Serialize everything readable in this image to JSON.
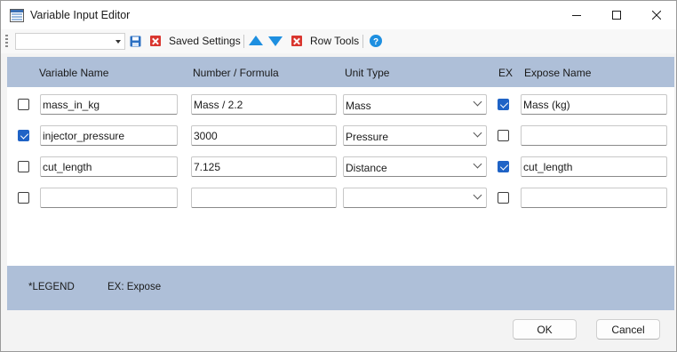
{
  "window": {
    "title": "Variable Input Editor",
    "app_icon": "spreadsheet-icon",
    "controls": [
      "minimize-icon",
      "maximize-icon",
      "close-icon"
    ]
  },
  "toolbar": {
    "combo_value": "",
    "save_icon": "floppy-disk-icon",
    "saved_settings_label": "Saved Settings",
    "move_up_icon": "arrow-up-icon",
    "move_down_icon": "arrow-down-icon",
    "row_tools_label": "Row Tools",
    "help_icon": "help-icon",
    "icon_colors": {
      "delete": "#d9362f",
      "arrows": "#1e8fe0",
      "help": "#1e8fe0",
      "save": "#2b6fc2"
    }
  },
  "grid": {
    "header_color": "#aebfd8",
    "columns": {
      "variable_name": "Variable Name",
      "number_formula": "Number / Formula",
      "unit_type": "Unit Type",
      "ex": "EX",
      "expose_name": "Expose Name"
    },
    "rows": [
      {
        "selected": false,
        "name": "mass_in_kg",
        "formula": "Mass / 2.2",
        "unit": "Mass",
        "expose": true,
        "expose_name": "Mass (kg)"
      },
      {
        "selected": true,
        "name": "injector_pressure",
        "formula": "3000",
        "unit": "Pressure",
        "expose": false,
        "expose_name": ""
      },
      {
        "selected": false,
        "name": "cut_length",
        "formula": "7.125",
        "unit": "Distance",
        "expose": true,
        "expose_name": "cut_length"
      },
      {
        "selected": false,
        "name": "",
        "formula": "",
        "unit": "",
        "expose": false,
        "expose_name": ""
      }
    ]
  },
  "legend": {
    "title": "*LEGEND",
    "ex_note": "EX: Expose"
  },
  "buttons": {
    "ok": "OK",
    "cancel": "Cancel"
  }
}
